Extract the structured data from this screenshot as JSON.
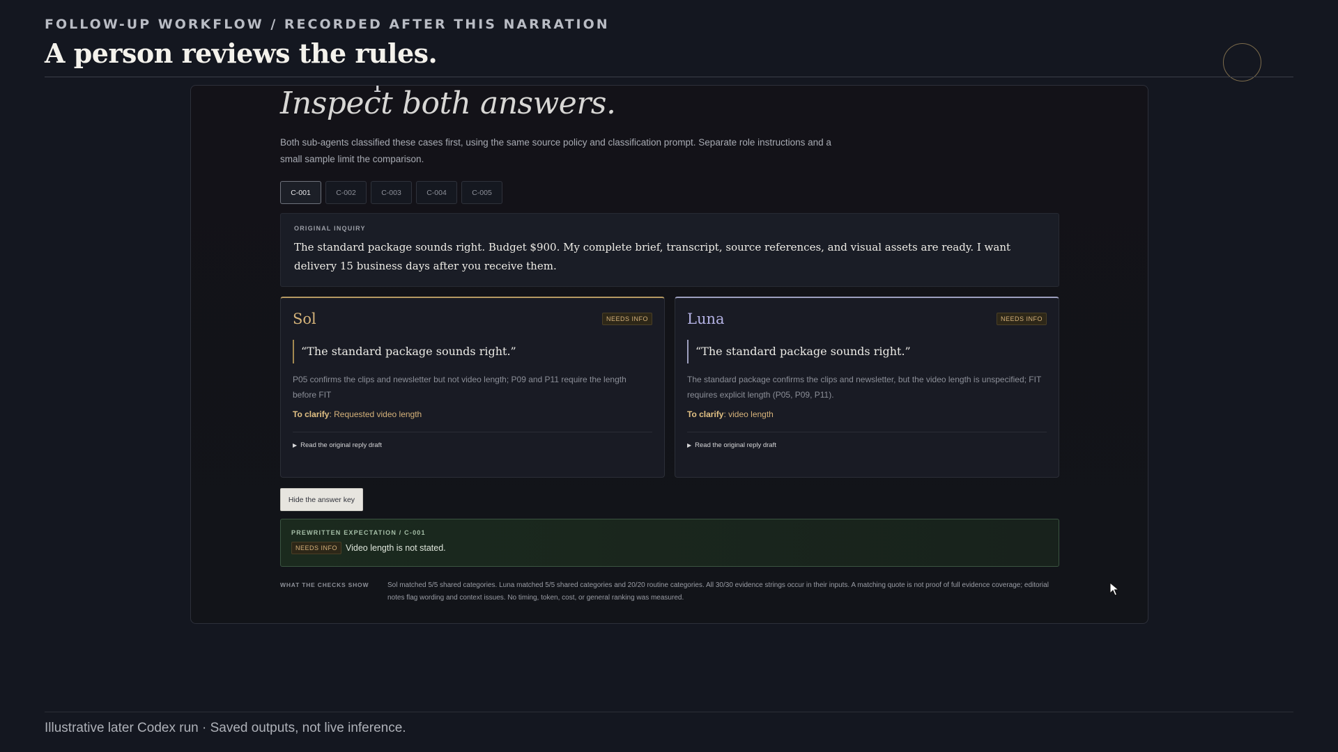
{
  "header": {
    "eyebrow": "FOLLOW-UP WORKFLOW / RECORDED AFTER THIS NARRATION",
    "title": "A person reviews the rules."
  },
  "panel": {
    "title": "Inspect both answers.",
    "intro": "Both sub-agents classified these cases first, using the same source policy and classification prompt. Separate role instructions and a small sample limit the comparison.",
    "tabs": [
      "C-001",
      "C-002",
      "C-003",
      "C-004",
      "C-005"
    ],
    "active_tab": "C-001",
    "inquiry": {
      "label": "ORIGINAL INQUIRY",
      "text": "The standard package sounds right. Budget $900. My complete brief, transcript, source references, and visual assets are ready. I want delivery 15 business days after you receive them."
    },
    "agents": [
      {
        "name": "Sol",
        "badge": "NEEDS INFO",
        "quote": "“The standard package sounds right.”",
        "reason": "P05 confirms the clips and newsletter but not video length; P09 and P11 require the length before FIT",
        "clarify_label": "To clarify",
        "clarify_value": ": Requested video length",
        "details_label": "Read the original reply draft"
      },
      {
        "name": "Luna",
        "badge": "NEEDS INFO",
        "quote": "“The standard package sounds right.”",
        "reason": "The standard package confirms the clips and newsletter, but the video length is unspecified; FIT requires explicit length (P05, P09, P11).",
        "clarify_label": "To clarify",
        "clarify_value": ": video length",
        "details_label": "Read the original reply draft"
      }
    ],
    "hide_button": "Hide the answer key",
    "expectation": {
      "label": "PREWRITTEN EXPECTATION / C-001",
      "badge": "NEEDS INFO",
      "text": "Video length is not stated."
    },
    "checks": {
      "label": "WHAT THE CHECKS SHOW",
      "text": "Sol matched 5/5 shared categories. Luna matched 5/5 shared categories and 20/20 routine categories. All 30/30 evidence strings occur in their inputs. A matching quote is not proof of full evidence coverage; editorial notes flag wording and context issues. No timing, token, cost, or general ranking was measured."
    }
  },
  "footer": {
    "text": "Illustrative later Codex run · Saved outputs, not live inference."
  },
  "colors": {
    "background": "#141720",
    "sol_accent": "#d6b47a",
    "luna_accent": "#b4b2e4",
    "expectation_green": "#1b2a1e"
  },
  "icons": [
    "record-circle-icon",
    "disclosure-triangle-icon",
    "mouse-cursor-icon"
  ]
}
